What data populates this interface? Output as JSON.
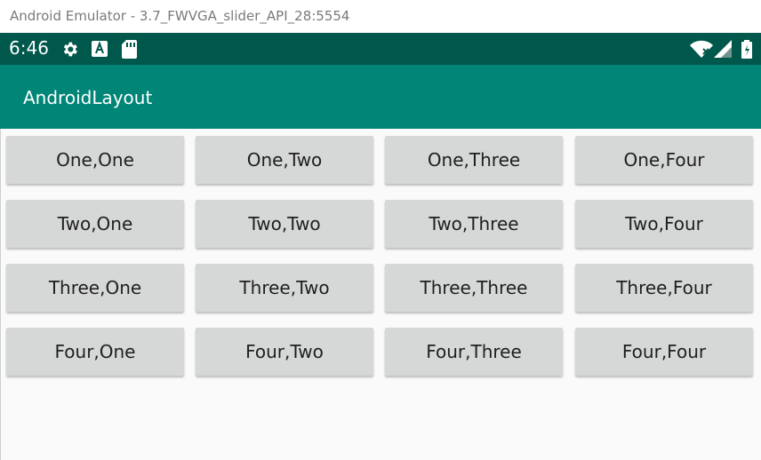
{
  "window": {
    "title": "Android Emulator - 3.7_FWVGA_slider_API_28:5554"
  },
  "status_bar": {
    "time": "6:46",
    "icons": [
      "gear-icon",
      "a-notification-icon",
      "sd-card-icon",
      "wifi-icon",
      "cellular-signal-icon",
      "battery-icon"
    ]
  },
  "app_bar": {
    "title": "AndroidLayout"
  },
  "grid": {
    "buttons": [
      "One,One",
      "One,Two",
      "One,Three",
      "One,Four",
      "Two,One",
      "Two,Two",
      "Two,Three",
      "Two,Four",
      "Three,One",
      "Three,Two",
      "Three,Three",
      "Three,Four",
      "Four,One",
      "Four,Two",
      "Four,Three",
      "Four,Four"
    ]
  },
  "colors": {
    "status_bar": "#00574b",
    "app_bar": "#008577",
    "button": "#d6d7d7",
    "background": "#fafafa"
  }
}
